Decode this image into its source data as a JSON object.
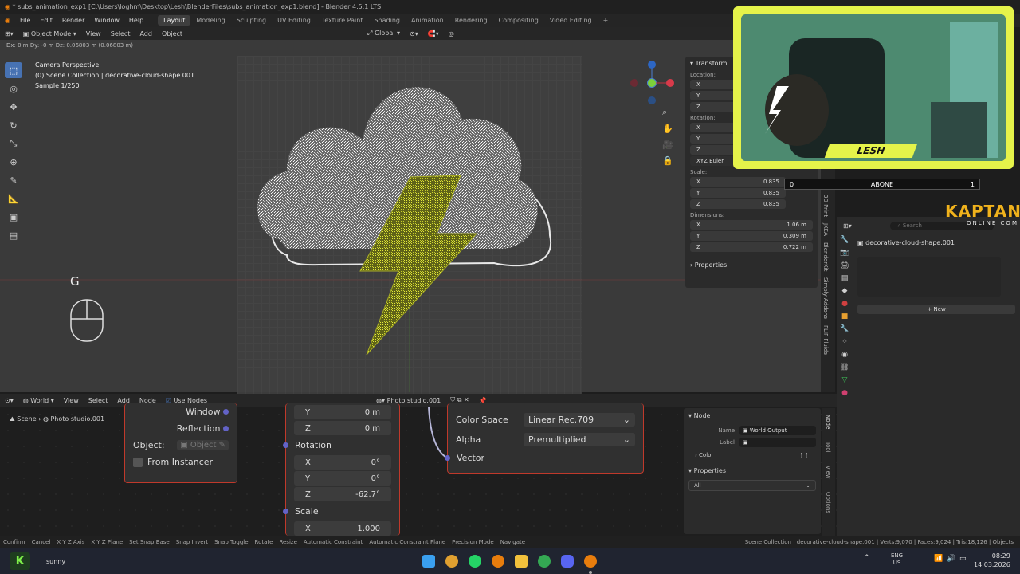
{
  "window": {
    "title": "* subs_animation_exp1 [C:\\Users\\loghm\\Desktop\\Lesh\\BlenderFiles\\subs_animation_exp1.blend] - Blender 4.5.1 LTS"
  },
  "menubar": {
    "items": [
      "File",
      "Edit",
      "Render",
      "Window",
      "Help"
    ],
    "workspaces": [
      "Layout",
      "Modeling",
      "Sculpting",
      "UV Editing",
      "Texture Paint",
      "Shading",
      "Animation",
      "Rendering",
      "Compositing",
      "Video Editing"
    ],
    "active_workspace": "Layout"
  },
  "viewport_header": {
    "mode": "Object Mode",
    "menus": [
      "View",
      "Select",
      "Add",
      "Object"
    ],
    "orientation": "Global"
  },
  "status_top": "Dx: 0 m  Dy: -0 m  Dz: 0.06803 m (0.06803 m)",
  "viewport_overlay": {
    "line1": "Camera Perspective",
    "line2": "(0) Scene Collection | decorative-cloud-shape.001",
    "line3": "Sample 1/250",
    "key_hint": "G"
  },
  "n_panel": {
    "transform_label": "Transform",
    "location_label": "Location:",
    "rotation_label": "Rotation:",
    "rotation_mode": "XYZ Euler",
    "scale_label": "Scale:",
    "scale": {
      "x": "0.835",
      "y": "0.835",
      "z": "0.835"
    },
    "dimensions_label": "Dimensions:",
    "dimensions": {
      "x": "1.06 m",
      "y": "0.309 m",
      "z": "0.722 m"
    },
    "properties_label": "Properties",
    "axes": [
      "X",
      "Y",
      "Z"
    ]
  },
  "sidebar_tabs": [
    "3D Print",
    "JKEA",
    "BlenderKit",
    "Simply Addons",
    "FLIP Fluids"
  ],
  "webcam": {
    "name": "LESH"
  },
  "abone_bar": {
    "left": "0",
    "label": "ABONE",
    "right": "1"
  },
  "kaptan": {
    "line1": "KAPTAN",
    "line2": "ONLINE.COM"
  },
  "properties_editor": {
    "search_placeholder": "Search",
    "object_name": "decorative-cloud-shape.001",
    "new_button": "New"
  },
  "node_header": {
    "editor": "World",
    "menus": [
      "View",
      "Select",
      "Add",
      "Node"
    ],
    "use_nodes": "Use Nodes",
    "world_name": "Photo studio.001"
  },
  "breadcrumb": {
    "scene": "Scene",
    "world": "Photo studio.001"
  },
  "node_texcoord": {
    "window": "Window",
    "reflection": "Reflection",
    "object_label": "Object:",
    "object_placeholder": "Object",
    "from_instancer": "From Instancer"
  },
  "node_mapping": {
    "y_loc": "0 m",
    "z_loc": "0 m",
    "rotation": "Rotation",
    "rx": "0°",
    "ry": "0°",
    "rz": "-62.7°",
    "scale": "Scale",
    "sx": "1.000"
  },
  "node_image": {
    "color_space_label": "Color Space",
    "color_space": "Linear Rec.709",
    "alpha_label": "Alpha",
    "alpha": "Premultiplied",
    "vector": "Vector"
  },
  "node_sidebar": {
    "node_label": "Node",
    "name_label": "Name",
    "name_value": "World Output",
    "label_label": "Label",
    "color_label": "Color",
    "properties_label": "Properties",
    "target": "All"
  },
  "node_side_tabs": [
    "Node",
    "Tool",
    "View",
    "Options"
  ],
  "statusbar": {
    "items": [
      "Confirm",
      "Cancel",
      "X Y Z Axis",
      "X Y Z Plane",
      "Set Snap Base",
      "Snap Invert",
      "Snap Toggle",
      "Rotate",
      "Resize",
      "Automatic Constraint",
      "Automatic Constraint Plane",
      "Precision Mode",
      "Navigate"
    ],
    "info": "Scene Collection | decorative-cloud-shape.001 | Verts:9,070 | Faces:9,024 | Tris:18,126 | Objects"
  },
  "taskbar": {
    "user": "sunny",
    "lang1": "ENG",
    "lang2": "US",
    "time": "08:29",
    "date": "14.03.2026"
  },
  "colors": {
    "accent": "#4772b3",
    "webcam_frame": "#e5f34a",
    "bolt": "#c6cc2a",
    "node_border": "#c0392b"
  }
}
